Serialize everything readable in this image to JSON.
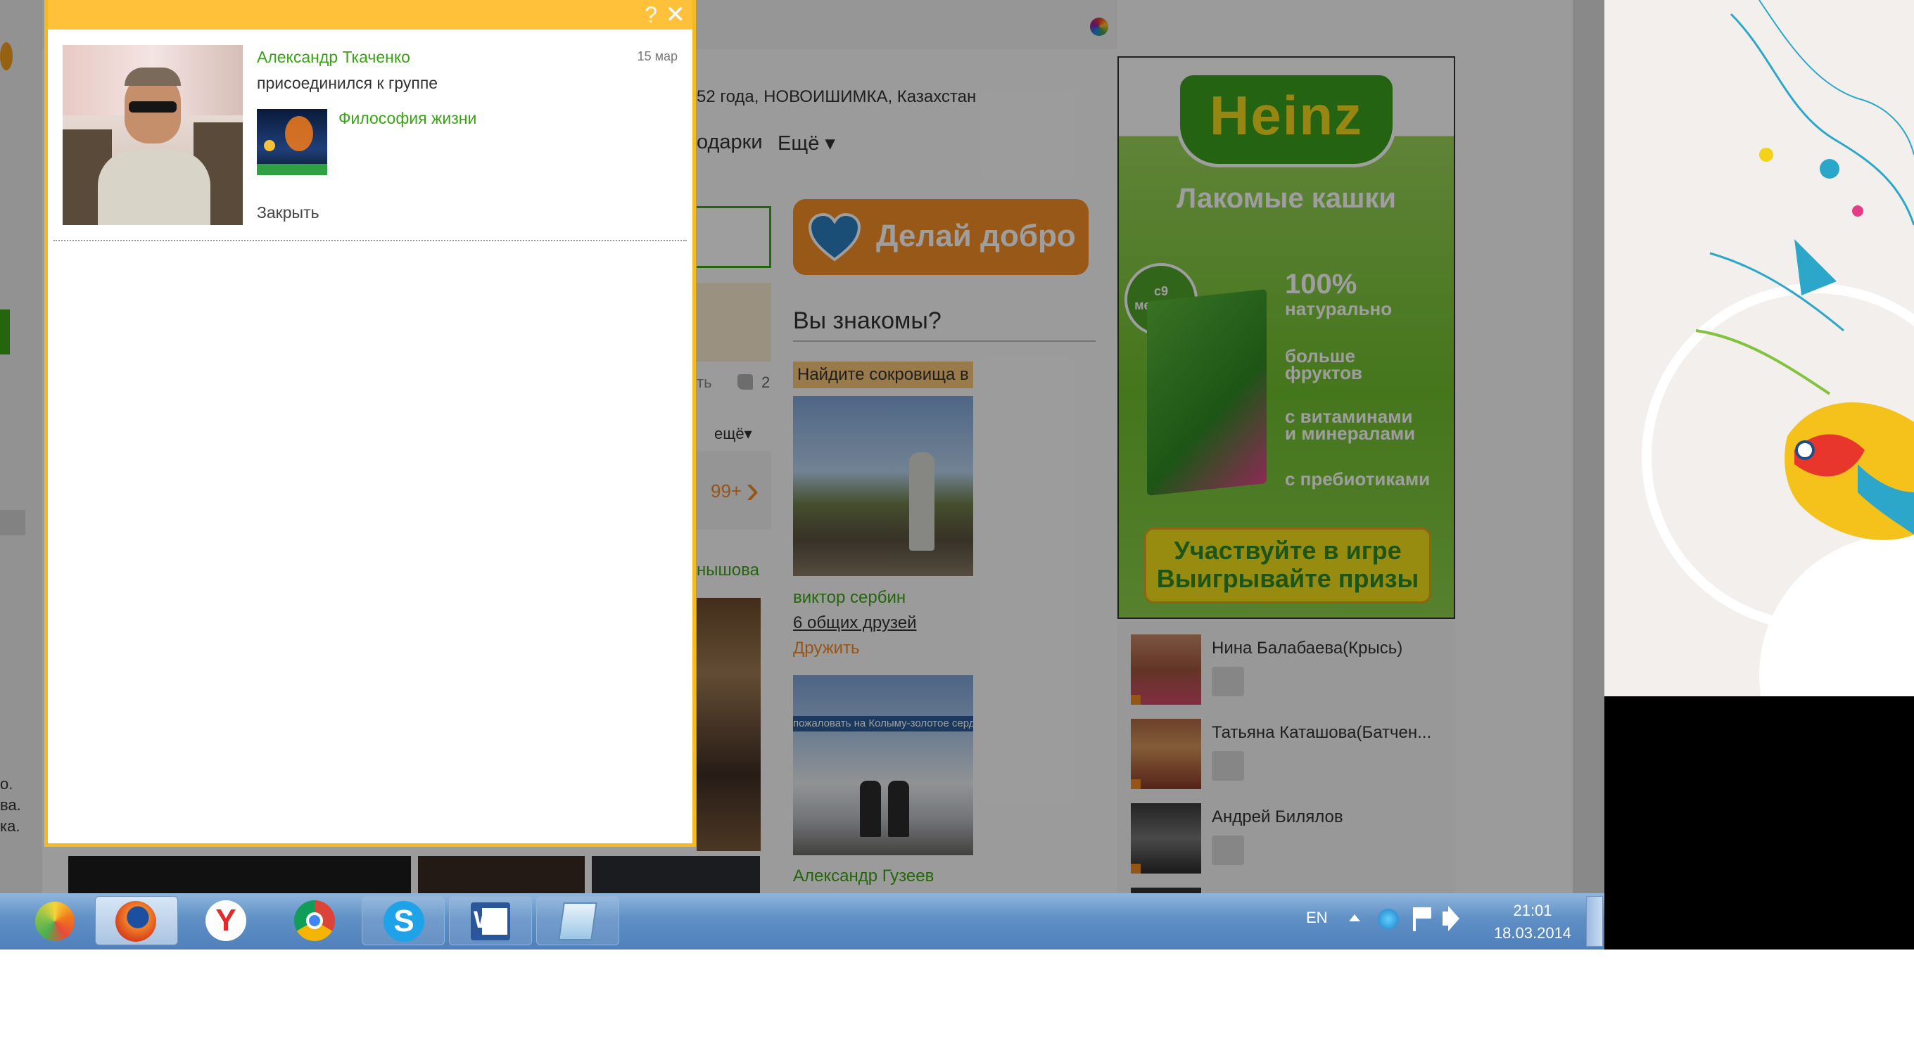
{
  "popup": {
    "help_label": "?",
    "close_label": "✕",
    "notification": {
      "user_name": "Александр Ткаченко",
      "date": "15 мар",
      "action": "присоединился к группе",
      "group_name": "Философия жизни",
      "close_link": "Закрыть"
    }
  },
  "profile": {
    "info_line": "52 года, НОВОИШИМКА, Казахстан",
    "nav_gifts": "одарки",
    "nav_more": "Ещё ▾",
    "likes_count": "2",
    "like_label": "ть",
    "more_label": "ещё▾",
    "counter": "99+",
    "friend_name_partial": "нышова"
  },
  "promo_button": {
    "label": "Делай добро"
  },
  "suggestions": {
    "title": "Вы знакомы?",
    "banner": "Найдите сокровища в",
    "people": [
      {
        "name": "виктор сербин",
        "mutual": "6 общих друзей",
        "action": "Дружить"
      },
      {
        "name": "Александр Гузеев",
        "photo_caption": "пожаловать на Колыму-золотое сердце Р"
      }
    ]
  },
  "ad": {
    "brand": "Heinz",
    "headline": "Лакомые кашки",
    "age_badge": "с9 месяцев",
    "claims": [
      "100%",
      "натурально",
      "больше",
      "фруктов",
      "с витаминами",
      "и минералами",
      "с пребиотиками"
    ],
    "cta_line1": "Участвуйте в игре",
    "cta_line2": "Выигрывайте призы"
  },
  "online_friends": [
    {
      "name": "Нина Балабаева(Крысь)"
    },
    {
      "name": "Татьяна Каташова(Батчен..."
    },
    {
      "name": "Андрей Билялов"
    }
  ],
  "left_edge_text": [
    "о.",
    "ва.",
    "ка."
  ],
  "taskbar": {
    "language": "EN",
    "time": "21:01",
    "date": "18.03.2014",
    "apps": [
      "app-launcher",
      "firefox",
      "yandex-browser",
      "chrome",
      "skype",
      "word",
      "notepad"
    ]
  },
  "colors": {
    "accent_green": "#3aa315",
    "orange": "#f08a24",
    "popup_border": "#f6b91e"
  }
}
